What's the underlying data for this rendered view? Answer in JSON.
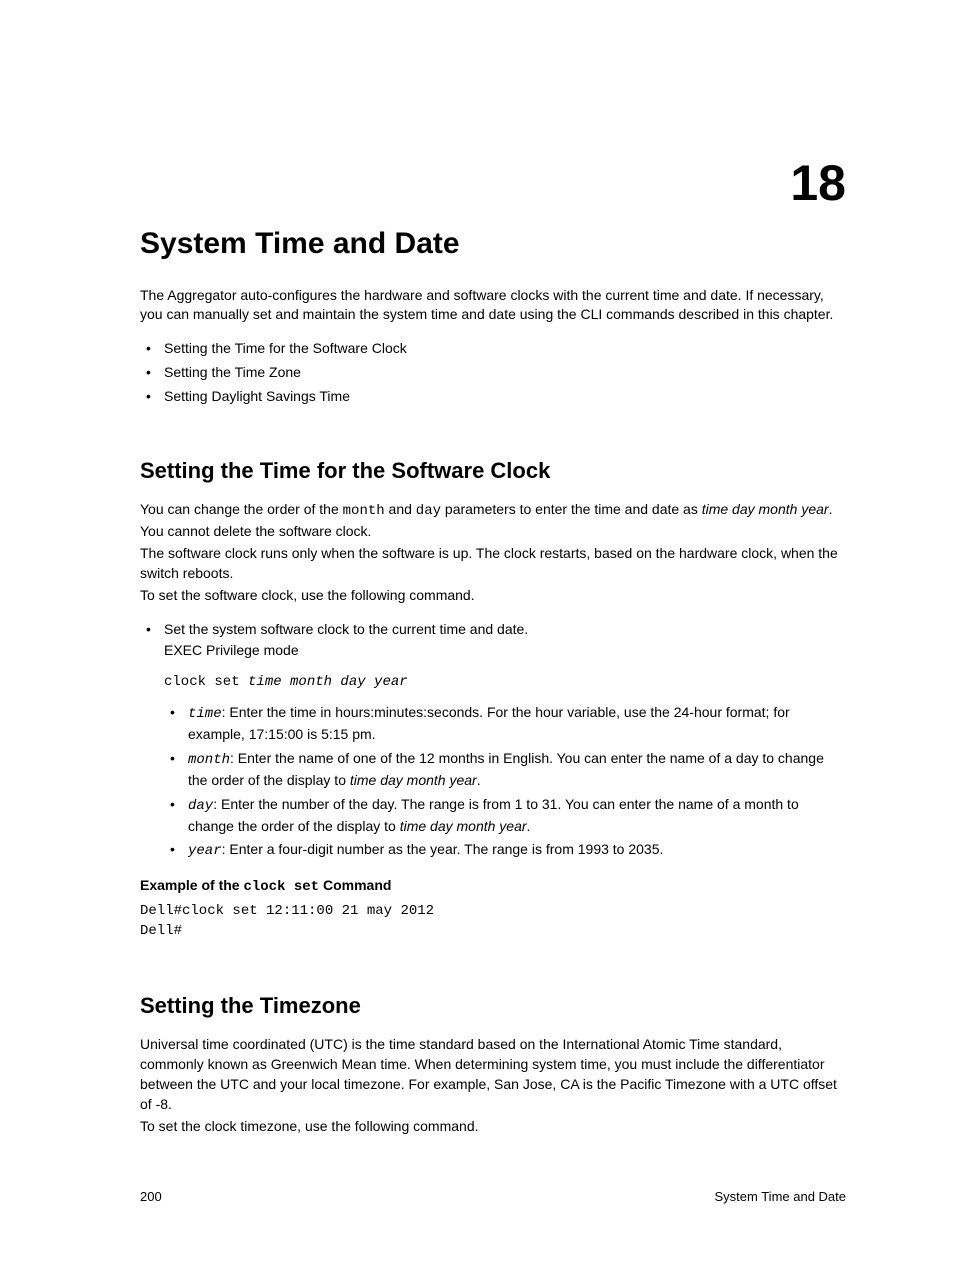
{
  "chapterNumber": "18",
  "title": "System Time and Date",
  "intro": "The Aggregator auto-configures the hardware and software clocks with the current time and date. If necessary, you can manually set and maintain the system time and date using the CLI commands described in this chapter.",
  "topics": [
    "Setting the Time for the Software Clock",
    "Setting the Time Zone",
    "Setting Daylight Savings Time"
  ],
  "section1": {
    "heading": "Setting the Time for the Software Clock",
    "p1a": "You can change the order of the ",
    "p1_code1": "month",
    "p1b": " and ",
    "p1_code2": "day",
    "p1c": " parameters to enter the time and date as ",
    "p1_italic": "time day month year",
    "p1d": ". You cannot delete the software clock.",
    "p2": "The software clock runs only when the software is up. The clock restarts, based on the hardware clock, when the switch reboots.",
    "p3": "To set the software clock, use the following command.",
    "step1": "Set the system software clock to the current time and date.",
    "mode": "EXEC Privilege mode",
    "cmd_prefix": "clock set ",
    "cmd_args": "time month day year",
    "params": [
      {
        "name": "time",
        "desc": ": Enter the time in hours:minutes:seconds. For the hour variable, use the 24-hour format; for example, 17:15:00 is 5:15 pm."
      },
      {
        "name": "month",
        "desc_a": ": Enter the name of one of the 12 months in English. You can enter the name of a day to change the order of the display to ",
        "desc_italic": "time day month year",
        "desc_b": "."
      },
      {
        "name": "day",
        "desc_a": ": Enter the number of the day. The range is from 1 to 31. You can enter the name of a month to change the order of the display to ",
        "desc_italic": "time day month year",
        "desc_b": "."
      },
      {
        "name": "year",
        "desc": ": Enter a four-digit number as the year. The range is from 1993 to 2035."
      }
    ],
    "example_title_a": "Example of the ",
    "example_title_code": "clock set",
    "example_title_b": " Command",
    "example_code": "Dell#clock set 12:11:00 21 may 2012\nDell#"
  },
  "section2": {
    "heading": "Setting the Timezone",
    "p1": "Universal time coordinated (UTC) is the time standard based on the International Atomic Time standard, commonly known as Greenwich Mean time. When determining system time, you must include the differentiator between the UTC and your local timezone. For example, San Jose, CA is the Pacific Timezone with a UTC offset of -8.",
    "p2": "To set the clock timezone, use the following command."
  },
  "footer": {
    "pageNum": "200",
    "sectionTitle": "System Time and Date"
  }
}
